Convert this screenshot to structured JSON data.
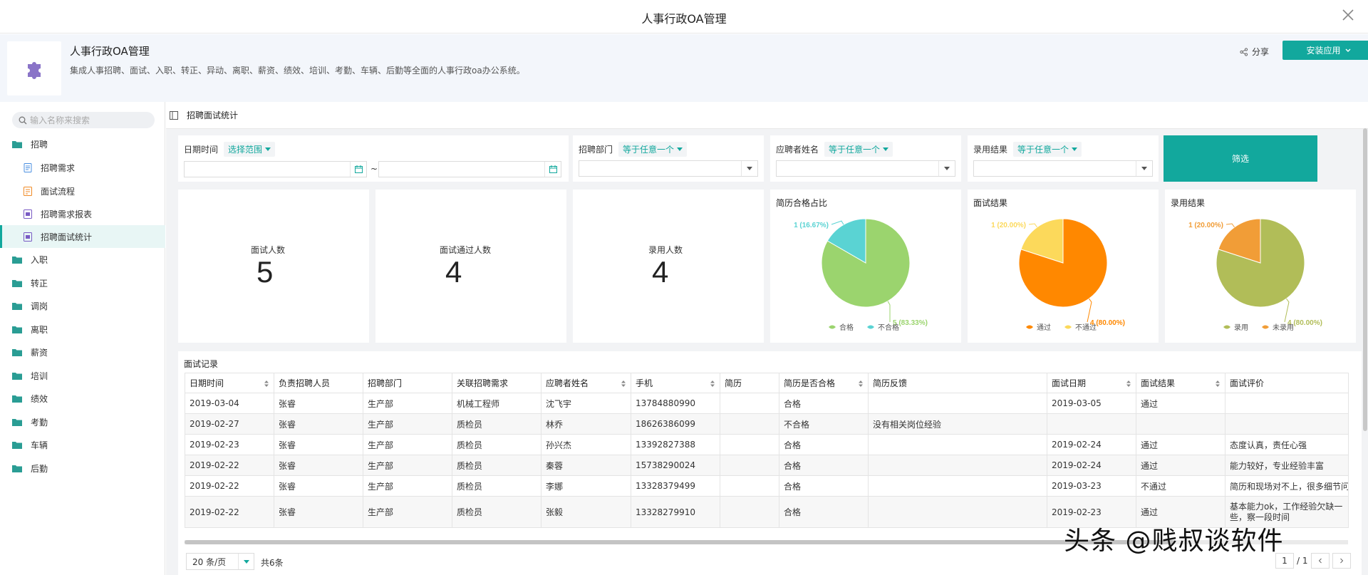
{
  "window": {
    "title": "人事行政OA管理"
  },
  "app": {
    "name": "人事行政OA管理",
    "description": "集成人事招聘、面试、入职、转正、异动、离职、薪资、绩效、培训、考勤、车辆、后勤等全面的人事行政oa办公系统。",
    "share_label": "分享",
    "install_label": "安装应用"
  },
  "sidebar": {
    "search_placeholder": "输入名称来搜索",
    "groups": [
      {
        "label": "招聘",
        "children": [
          {
            "label": "招聘需求"
          },
          {
            "label": "面试流程"
          },
          {
            "label": "招聘需求报表"
          },
          {
            "label": "招聘面试统计"
          }
        ]
      },
      {
        "label": "入职"
      },
      {
        "label": "转正"
      },
      {
        "label": "调岗"
      },
      {
        "label": "离职"
      },
      {
        "label": "薪资"
      },
      {
        "label": "培训"
      },
      {
        "label": "绩效"
      },
      {
        "label": "考勤"
      },
      {
        "label": "车辆"
      },
      {
        "label": "后勤"
      }
    ]
  },
  "page": {
    "breadcrumb": "招聘面试统计"
  },
  "filters": {
    "date": {
      "label": "日期时间",
      "mode": "选择范围",
      "separator": "~"
    },
    "department": {
      "label": "招聘部门",
      "mode": "等于任意一个"
    },
    "applicant": {
      "label": "应聘者姓名",
      "mode": "等于任意一个"
    },
    "hire_result": {
      "label": "录用结果",
      "mode": "等于任意一个"
    },
    "submit_label": "筛选"
  },
  "stats": [
    {
      "label": "面试人数",
      "value": "5"
    },
    {
      "label": "面试通过人数",
      "value": "4"
    },
    {
      "label": "录用人数",
      "value": "4"
    }
  ],
  "colors": {
    "accent": "#12a89d"
  },
  "chart_data": [
    {
      "type": "pie",
      "title": "简历合格占比",
      "slices": [
        {
          "name": "合格",
          "value": 5,
          "label": "5 (83.33%)",
          "color": "#9bd46e"
        },
        {
          "name": "不合格",
          "value": 1,
          "label": "1 (16.67%)",
          "color": "#5ad3d3"
        }
      ]
    },
    {
      "type": "pie",
      "title": "面试结果",
      "slices": [
        {
          "name": "通过",
          "value": 4,
          "label": "4 (80.00%)",
          "color": "#ff8800"
        },
        {
          "name": "不通过",
          "value": 1,
          "label": "1 (20.00%)",
          "color": "#fcd95b"
        }
      ]
    },
    {
      "type": "pie",
      "title": "录用结果",
      "slices": [
        {
          "name": "录用",
          "value": 4,
          "label": "4 (80.00%)",
          "color": "#b1bd58"
        },
        {
          "name": "未录用",
          "value": 1,
          "label": "1 (20.00%)",
          "color": "#f19d37"
        }
      ]
    }
  ],
  "table": {
    "title": "面试记录",
    "columns": [
      "日期时间",
      "负责招聘人员",
      "招聘部门",
      "关联招聘需求",
      "应聘者姓名",
      "手机",
      "简历",
      "简历是否合格",
      "简历反馈",
      "面试日期",
      "面试结果",
      "面试评价"
    ],
    "rows": [
      [
        "2019-03-04",
        "张睿",
        "生产部",
        "机械工程师",
        "沈飞宇",
        "13784880990",
        "",
        "合格",
        "",
        "2019-03-05",
        "通过",
        ""
      ],
      [
        "2019-02-27",
        "张睿",
        "生产部",
        "质检员",
        "林乔",
        "18626386099",
        "",
        "不合格",
        "没有相关岗位经验",
        "",
        "",
        ""
      ],
      [
        "2019-02-23",
        "张睿",
        "生产部",
        "质检员",
        "孙兴杰",
        "13392827388",
        "",
        "合格",
        "",
        "2019-02-24",
        "通过",
        "态度认真，责任心强"
      ],
      [
        "2019-02-22",
        "张睿",
        "生产部",
        "质检员",
        "秦蓉",
        "15738290024",
        "",
        "合格",
        "",
        "2019-02-24",
        "通过",
        "能力较好，专业经验丰富"
      ],
      [
        "2019-02-22",
        "张睿",
        "生产部",
        "质检员",
        "李娜",
        "13328379499",
        "",
        "合格",
        "",
        "2019-03-23",
        "不通过",
        "简历和现场对不上，很多细节问"
      ],
      [
        "2019-02-22",
        "张睿",
        "生产部",
        "质检员",
        "张毅",
        "13328279910",
        "",
        "合格",
        "",
        "2019-02-23",
        "通过",
        "基本能力ok，工作经验欠缺一些，察一段时间"
      ]
    ]
  },
  "pager": {
    "size": "20 条/页",
    "total": "共6条",
    "current": "1",
    "pages": "/ 1"
  },
  "watermark": "头条 @贱叔谈软件"
}
